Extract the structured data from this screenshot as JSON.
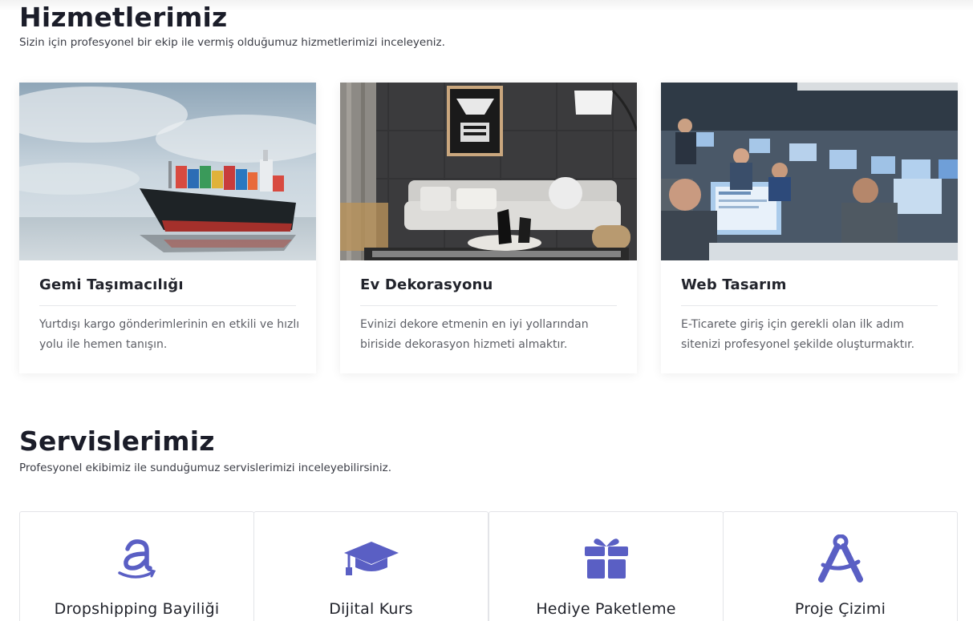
{
  "hizmetler": {
    "title": "Hizmetlerimiz",
    "subtitle": "Sizin için profesyonel bir ekip ile vermiş olduğumuz hizmetlerimizi inceleyeniz.",
    "cards": [
      {
        "title": "Gemi Taşımacılığı",
        "text": "Yurtdışı kargo gönderimlerinin en etkili ve hızlı yolu ile hemen tanışın.",
        "image": "cargo-ship-image"
      },
      {
        "title": "Ev Dekorasyonu",
        "text": "Evinizi dekore etmenin en iyi yollarından biriside dekorasyon hizmeti almaktır.",
        "image": "living-room-image"
      },
      {
        "title": "Web Tasarım",
        "text": "E-Ticarete giriş için gerekli olan ilk adım sitenizi profesyonel şekilde oluşturmaktır.",
        "image": "office-workers-image"
      }
    ]
  },
  "servisler": {
    "title": "Servislerimiz",
    "subtitle": "Profesyonel ekibimiz ile sunduğumuz servislerimizi inceleyebilirsiniz.",
    "items": [
      {
        "title": "Dropshipping Bayiliği",
        "icon": "amazon-icon"
      },
      {
        "title": "Dijital Kurs",
        "icon": "graduation-cap-icon"
      },
      {
        "title": "Hediye Paketleme",
        "icon": "gift-icon"
      },
      {
        "title": "Proje Çizimi",
        "icon": "compass-drafting-icon"
      }
    ]
  },
  "colors": {
    "accent": "#5a5fc4",
    "heading": "#1b1d29",
    "body_text": "#5d5f66"
  }
}
